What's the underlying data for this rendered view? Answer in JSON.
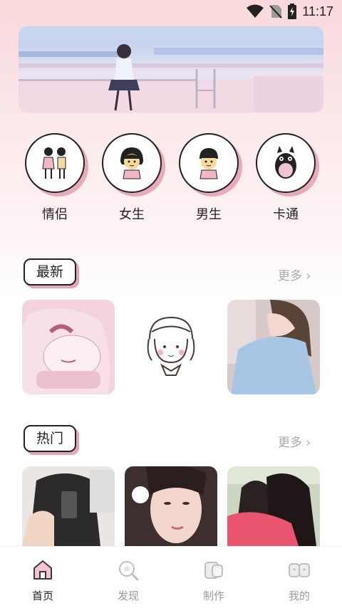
{
  "status_bar": {
    "time": "11:17"
  },
  "banner": {
    "image_desc": "anime-girl-rooftop"
  },
  "categories": [
    {
      "label": "情侣",
      "icon": "couple-icon"
    },
    {
      "label": "女生",
      "icon": "girl-icon"
    },
    {
      "label": "男生",
      "icon": "boy-icon"
    },
    {
      "label": "卡通",
      "icon": "totoro-icon"
    }
  ],
  "sections": {
    "latest": {
      "title": "最新",
      "more": "更多 ›"
    },
    "hot": {
      "title": "热门",
      "more": "更多 ›"
    }
  },
  "bottom_nav": [
    {
      "label": "首页",
      "icon": "home-icon",
      "active": true
    },
    {
      "label": "发现",
      "icon": "discover-icon",
      "active": false
    },
    {
      "label": "制作",
      "icon": "create-icon",
      "active": false
    },
    {
      "label": "我的",
      "icon": "profile-icon",
      "active": false
    }
  ],
  "colors": {
    "accent_pink": "#e7a4b6",
    "outline": "#222222"
  }
}
